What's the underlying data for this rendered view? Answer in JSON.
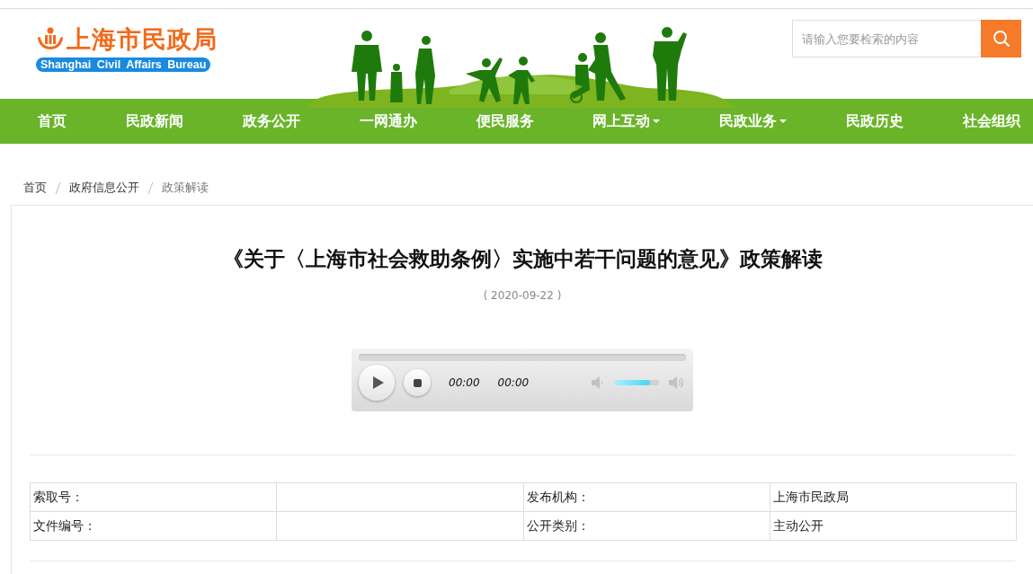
{
  "logo": {
    "title": "上海市民政局",
    "subtitle": "Shanghai Civil Affairs Bureau"
  },
  "search": {
    "placeholder": "请输入您要检索的内容"
  },
  "nav": [
    {
      "label": "首页",
      "dropdown": false
    },
    {
      "label": "民政新闻",
      "dropdown": false
    },
    {
      "label": "政务公开",
      "dropdown": false
    },
    {
      "label": "一网通办",
      "dropdown": false
    },
    {
      "label": "便民服务",
      "dropdown": false
    },
    {
      "label": "网上互动",
      "dropdown": true
    },
    {
      "label": "民政业务",
      "dropdown": true
    },
    {
      "label": "民政历史",
      "dropdown": false
    },
    {
      "label": "社会组织",
      "dropdown": false
    }
  ],
  "breadcrumb": [
    {
      "label": "首页",
      "current": false
    },
    {
      "label": "政府信息公开",
      "current": false
    },
    {
      "label": "政策解读",
      "current": true
    }
  ],
  "article": {
    "title": "《关于〈上海市社会救助条例〉实施中若干问题的意见》政策解读",
    "date": "( 2020-09-22 )"
  },
  "player": {
    "progress": {
      "level": 0
    },
    "elapsed": "00:00",
    "duration": "00:00",
    "volume": {
      "level": 0.8
    }
  },
  "info_table": [
    {
      "cells": [
        {
          "label": "索取号："
        },
        {
          "label": "发布机构：",
          "value": "上海市民政局"
        }
      ]
    },
    {
      "cells": [
        {
          "label": "文件编号："
        },
        {
          "label": "公开类别：",
          "value": "主动公开"
        }
      ]
    }
  ]
}
